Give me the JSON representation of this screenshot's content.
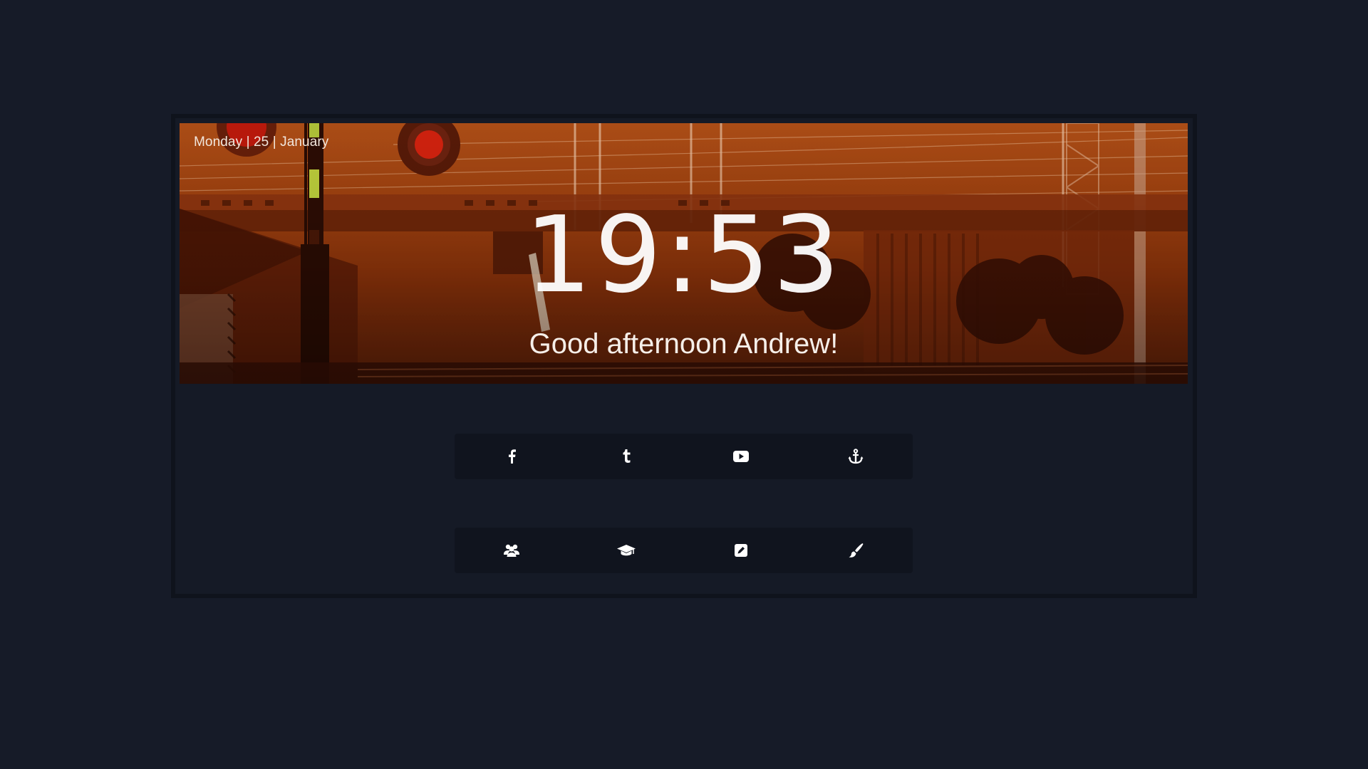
{
  "header": {
    "date": "Monday | 25 | January",
    "clock": "19:53",
    "greeting": "Good afternoon Andrew!"
  },
  "links_row_1": [
    {
      "icon": "facebook-icon"
    },
    {
      "icon": "tumblr-icon"
    },
    {
      "icon": "youtube-icon"
    },
    {
      "icon": "anchor-icon"
    }
  ],
  "links_row_2": [
    {
      "icon": "users-icon"
    },
    {
      "icon": "graduation-cap-icon"
    },
    {
      "icon": "edit-icon"
    },
    {
      "icon": "paint-brush-icon"
    }
  ],
  "colors": {
    "page_background": "#161b28",
    "icon_bar_background": "#10141e",
    "hero_tint": "#a2410f",
    "icon_color": "#ffffff"
  }
}
